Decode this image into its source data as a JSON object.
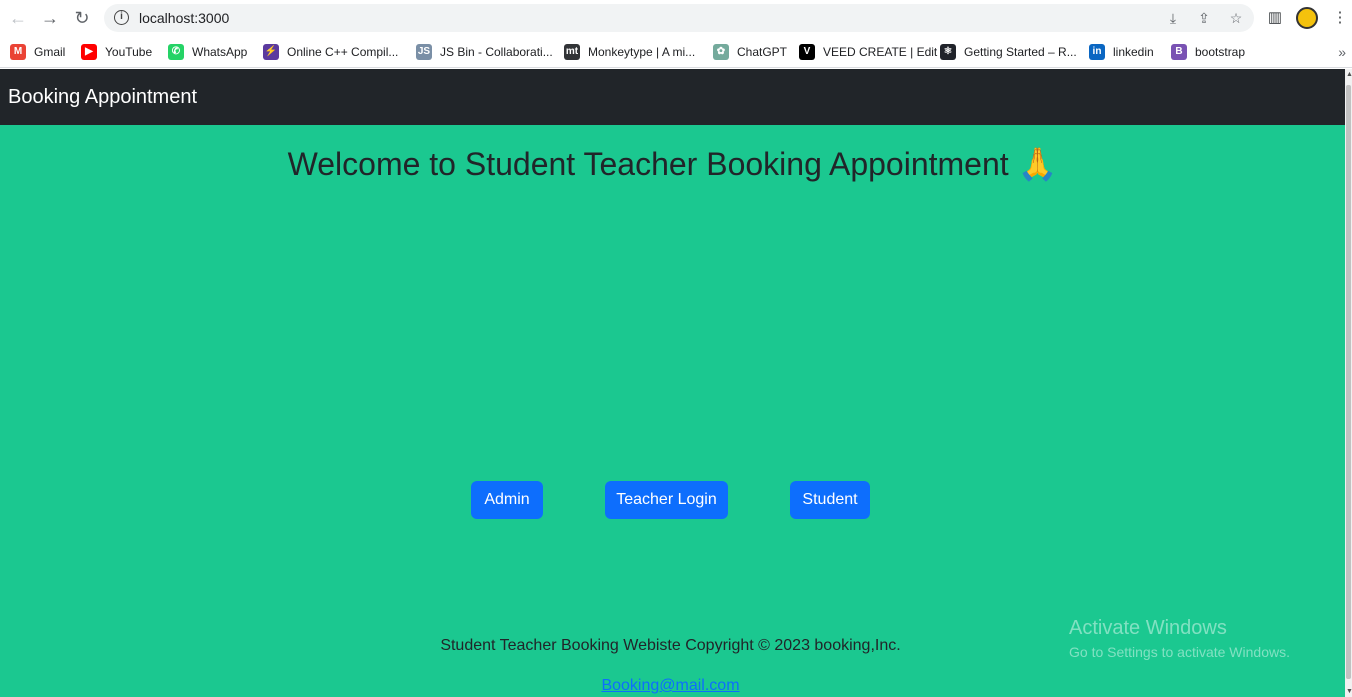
{
  "browser": {
    "url": "localhost:3000",
    "bookmarks": [
      {
        "label": "Gmail",
        "icon": "gmail-icon",
        "color": "#ea4335",
        "glyph": "M"
      },
      {
        "label": "YouTube",
        "icon": "youtube-icon",
        "color": "#ff0000",
        "glyph": "▶"
      },
      {
        "label": "WhatsApp",
        "icon": "whatsapp-icon",
        "color": "#25d366",
        "glyph": "✆"
      },
      {
        "label": "Online C++ Compil...",
        "icon": "replit-icon",
        "color": "#5b3a9e",
        "glyph": "⚡"
      },
      {
        "label": "JS Bin - Collaborati...",
        "icon": "jsbin-icon",
        "color": "#7a8fa6",
        "glyph": "JS"
      },
      {
        "label": "Monkeytype | A mi...",
        "icon": "monkeytype-icon",
        "color": "#323437",
        "glyph": "mt"
      },
      {
        "label": "ChatGPT",
        "icon": "chatgpt-icon",
        "color": "#74aa9c",
        "glyph": "✿"
      },
      {
        "label": "VEED CREATE | Edit",
        "icon": "veed-icon",
        "color": "#000000",
        "glyph": "V"
      },
      {
        "label": "Getting Started – R...",
        "icon": "react-icon",
        "color": "#20232a",
        "glyph": "⚛"
      },
      {
        "label": "linkedin",
        "icon": "linkedin-icon",
        "color": "#0a66c2",
        "glyph": "in"
      },
      {
        "label": "bootstrap",
        "icon": "bootstrap-icon",
        "color": "#7952b3",
        "glyph": "B"
      }
    ]
  },
  "navbar": {
    "brand": "Booking Appointment"
  },
  "main": {
    "title": "Welcome to Student Teacher Booking Appointment 🙏",
    "buttons": {
      "admin": "Admin",
      "teacher": "Teacher Login",
      "student": "Student"
    }
  },
  "footer": {
    "text": "Student Teacher Booking Webiste Copyright © 2023 booking,Inc.",
    "email": "Booking@mail.com"
  },
  "watermark": {
    "line1": "Activate Windows",
    "line2": "Go to Settings to activate Windows."
  },
  "colors": {
    "page_bg": "#1bc890",
    "navbar_bg": "#212529",
    "button_bg": "#0d6efd"
  }
}
